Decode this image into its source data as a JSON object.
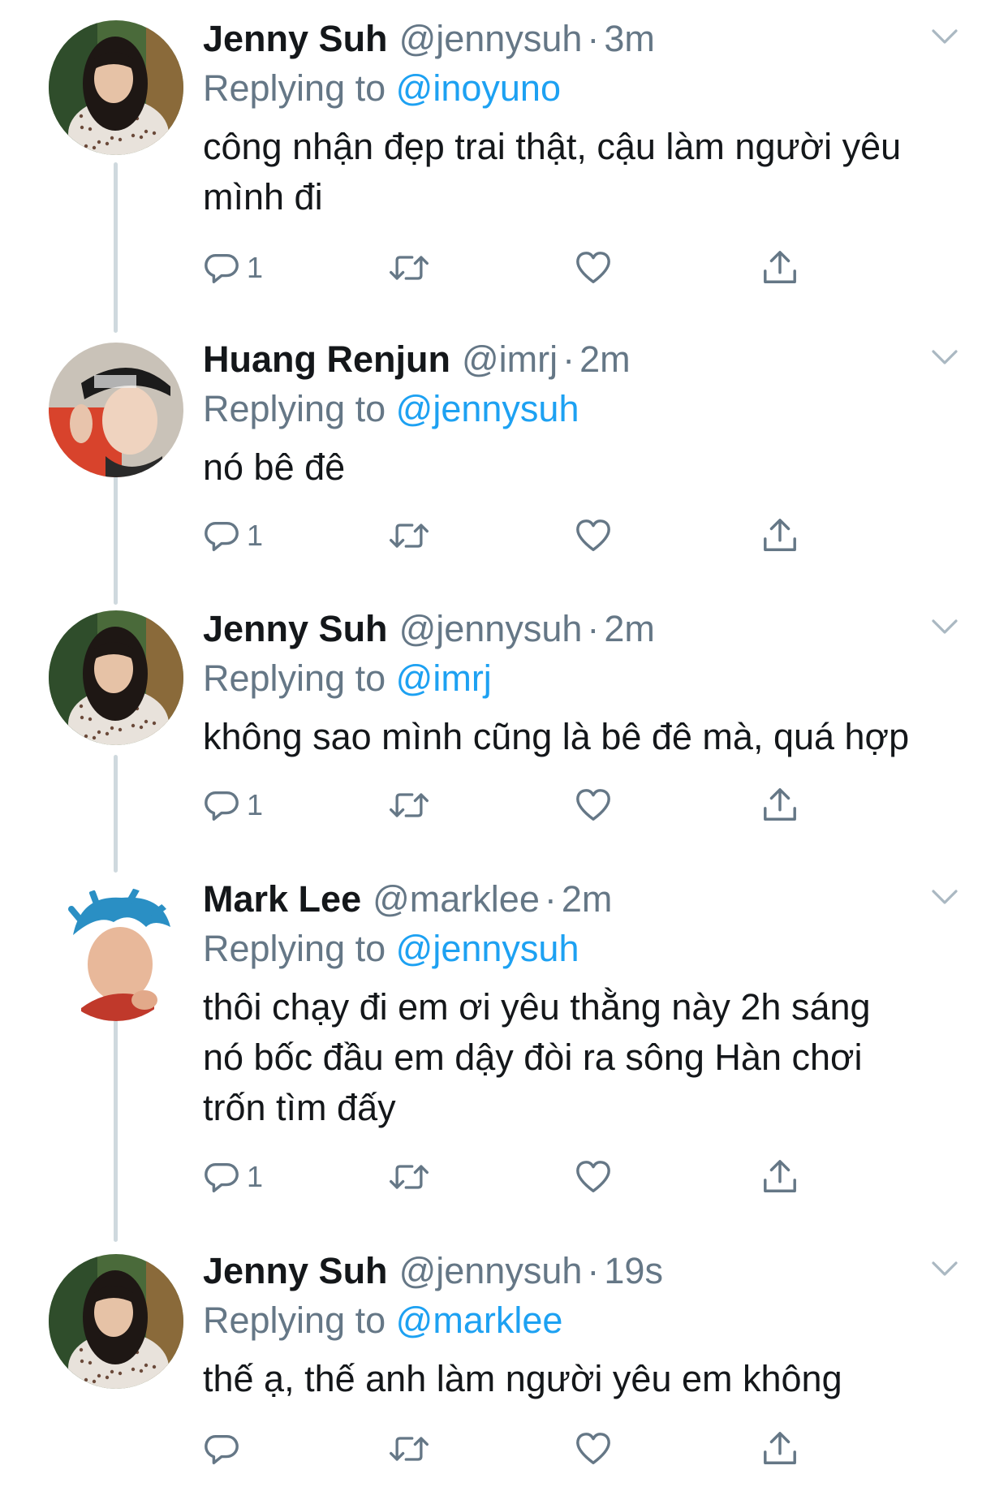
{
  "colors": {
    "link": "#1da1f2",
    "secondary_text": "#657786",
    "primary_text": "#14171a",
    "thread_line": "#cfd9de"
  },
  "icons": [
    "reply-icon",
    "retweet-icon",
    "like-icon",
    "share-icon",
    "chevron-down-icon"
  ],
  "tweets": [
    {
      "name": "Jenny Suh",
      "handle": "@jennysuh",
      "time": "3m",
      "replying_prefix": "Replying to",
      "replying_to": "@inoyuno",
      "text": "công nhận đẹp trai thật, cậu làm người yêu\nmình đi",
      "reply_count": "1"
    },
    {
      "name": "Huang Renjun",
      "handle": "@imrj",
      "time": "2m",
      "replying_prefix": "Replying to",
      "replying_to": "@jennysuh",
      "text": "nó bê đê",
      "reply_count": "1"
    },
    {
      "name": "Jenny Suh",
      "handle": "@jennysuh",
      "time": "2m",
      "replying_prefix": "Replying to",
      "replying_to": "@imrj",
      "text": "không sao mình cũng là bê đê mà, quá hợp",
      "reply_count": "1"
    },
    {
      "name": "Mark Lee",
      "handle": "@marklee",
      "time": "2m",
      "replying_prefix": "Replying to",
      "replying_to": "@jennysuh",
      "text": "thôi chạy đi em ơi yêu thằng này 2h sáng\nnó bốc đầu em dậy đòi ra sông Hàn chơi\ntrốn tìm đấy",
      "reply_count": "1"
    },
    {
      "name": "Jenny Suh",
      "handle": "@jennysuh",
      "time": "19s",
      "replying_prefix": "Replying to",
      "replying_to": "@marklee",
      "text": "thế ạ, thế anh làm người yêu em không",
      "reply_count": ""
    }
  ]
}
